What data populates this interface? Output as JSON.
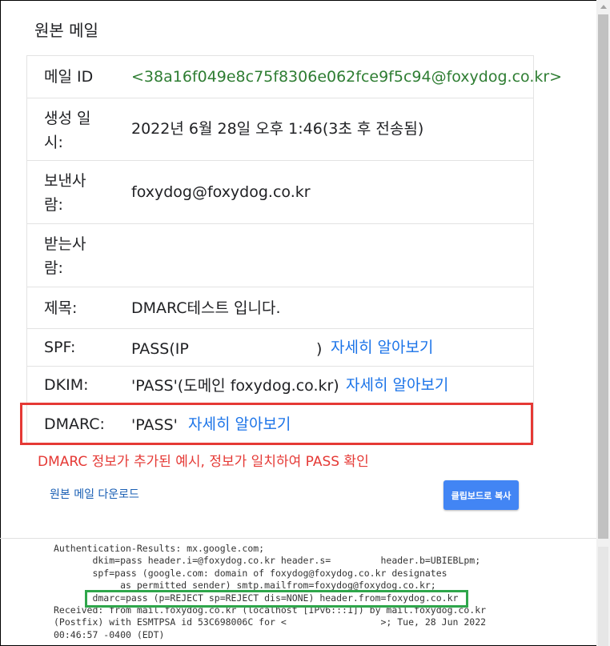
{
  "page_title": "원본 메일",
  "rows": {
    "mail_id": {
      "label": "메일 ID",
      "value": "<38a16f049e8c75f8306e062fce9f5c94@foxydog.co.kr>"
    },
    "created": {
      "label1": "생성 일",
      "label2": "시:",
      "value": "2022년 6월 28일 오후 1:46(3초 후 전송됨)"
    },
    "sender": {
      "label1": "보낸사",
      "label2": "람:",
      "value": "foxydog@foxydog.co.kr"
    },
    "recipient": {
      "label1": "받는사",
      "label2": "람:",
      "value": ""
    },
    "subject": {
      "label": "제목:",
      "value": "DMARC테스트 입니다."
    },
    "spf": {
      "label": "SPF:",
      "value": "PASS(IP",
      "value_close": ")",
      "link": "자세히 알아보기"
    },
    "dkim": {
      "label": "DKIM:",
      "value": "'PASS'(도메인 foxydog.co.kr)",
      "link": "자세히 알아보기"
    },
    "dmarc": {
      "label": "DMARC:",
      "value": "'PASS'",
      "link": "자세히 알아보기"
    }
  },
  "annotation": "DMARC 정보가 추가된 예시, 정보가 일치하여 PASS 확인",
  "download_link": "원본 메일 다운로드",
  "copy_button": "클립보드로 복사",
  "colors": {
    "accent": "#1a73e8",
    "highlight_red": "#e53935",
    "highlight_green": "#2fa64b",
    "message_id_green": "#2e7d32"
  },
  "raw_lines": [
    "Authentication-Results: mx.google.com;",
    "       dkim=pass header.i=@foxydog.co.kr header.s=         header.b=UBIEBLpm;",
    "       spf=pass (google.com: domain of foxydog@foxydog.co.kr designates",
    "            as permitted sender) smtp.mailfrom=foxydog@foxydog.co.kr;",
    "       dmarc=pass (p=REJECT sp=REJECT dis=NONE) header.from=foxydog.co.kr",
    "Received: from mail.foxydog.co.kr (localhost [IPv6:::1]) by mail.foxydog.co.kr",
    "(Postfix) with ESMTPSA id 53C698006C for <                 >; Tue, 28 Jun 2022",
    "00:46:57 -0400 (EDT)"
  ]
}
